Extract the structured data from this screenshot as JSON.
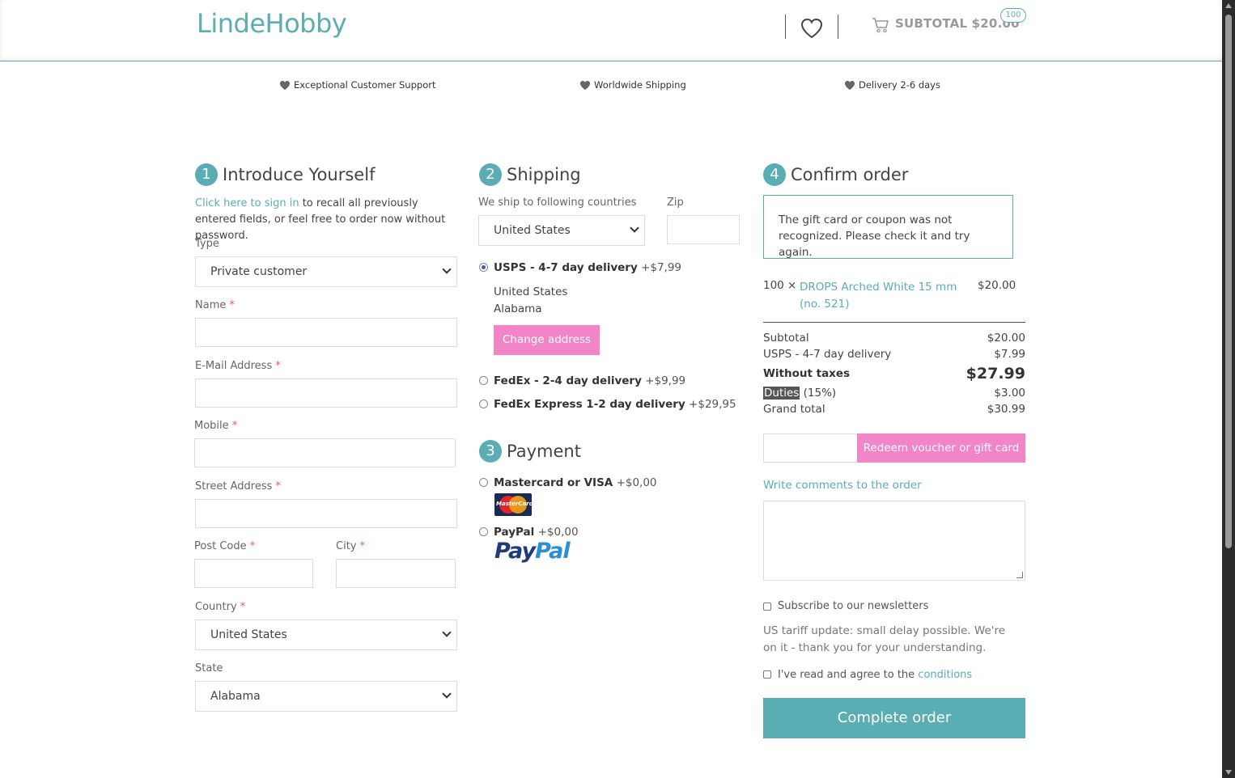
{
  "header": {
    "logo": "LindeHobby",
    "subtotal": "SUBTOTAL $20.00",
    "cart_badge": "100"
  },
  "usps": [
    "Exceptional Customer Support",
    "Worldwide Shipping",
    "Delivery 2-6 days"
  ],
  "step1": {
    "num": "1",
    "title": "Introduce Yourself",
    "signin_link": "Click here to sign in",
    "intro_rest": " to recall all previously entered fields, or feel free to order now without password.",
    "type_label": "Type",
    "type_value": "Private customer",
    "name_label": "Name",
    "email_label": "E-Mail Address",
    "mobile_label": "Mobile",
    "street_label": "Street Address",
    "postcode_label": "Post Code",
    "city_label": "City",
    "country_label": "Country",
    "country_value": "United States",
    "state_label": "State",
    "state_value": "Alabama",
    "required_mark": "*"
  },
  "step2": {
    "num": "2",
    "title": "Shipping",
    "countries_label": "We ship to following countries",
    "zip_label": "Zip",
    "country_value": "United States",
    "options": [
      {
        "name": "USPS - 4-7 day delivery",
        "price": "+$7,99",
        "selected": true
      },
      {
        "name": "FedEx - 2-4 day delivery",
        "price": "+$9,99",
        "selected": false
      },
      {
        "name": "FedEx Express 1-2 day delivery",
        "price": "+$29,95",
        "selected": false
      }
    ],
    "address_line1": "United States",
    "address_line2": "Alabama",
    "change_address": "Change address"
  },
  "step3": {
    "num": "3",
    "title": "Payment",
    "options": [
      {
        "name": "Mastercard or VISA",
        "price": "+$0,00"
      },
      {
        "name": "PayPal",
        "price": "+$0,00"
      }
    ],
    "mastercard_logo_text": "MasterCard",
    "paypal_logo_1": "Pay",
    "paypal_logo_2": "Pal"
  },
  "step4": {
    "num": "4",
    "title": "Confirm order",
    "message": "The gift card or coupon was not recognized. Please check it and try again.",
    "line_qty": "100 ×",
    "line_name": "DROPS Arched White 15 mm (no. 521)",
    "line_price": "$20.00",
    "totals": {
      "subtotal_label": "Subtotal",
      "subtotal": "$20.00",
      "shipping_label": "USPS - 4-7 day delivery",
      "shipping": "$7.99",
      "without_taxes_label": "Without taxes",
      "without_taxes": "$27.99",
      "duties_label": "Duties",
      "duties_pct": " (15%)",
      "duties": "$3.00",
      "grand_label": "Grand total",
      "grand": "$30.99"
    },
    "redeem_button": "Redeem voucher or gift card",
    "comments_link": "Write comments to the order",
    "newsletter_label": "Subscribe to our newsletters",
    "notice": "US tariff update: small delay possible. We're on it - thank you for your understanding.",
    "terms_label": "I've read and agree to the ",
    "terms_link": "conditions",
    "complete_button": "Complete order"
  },
  "colors": {
    "accent": "#5aadb2",
    "pink": "#f185c8"
  }
}
